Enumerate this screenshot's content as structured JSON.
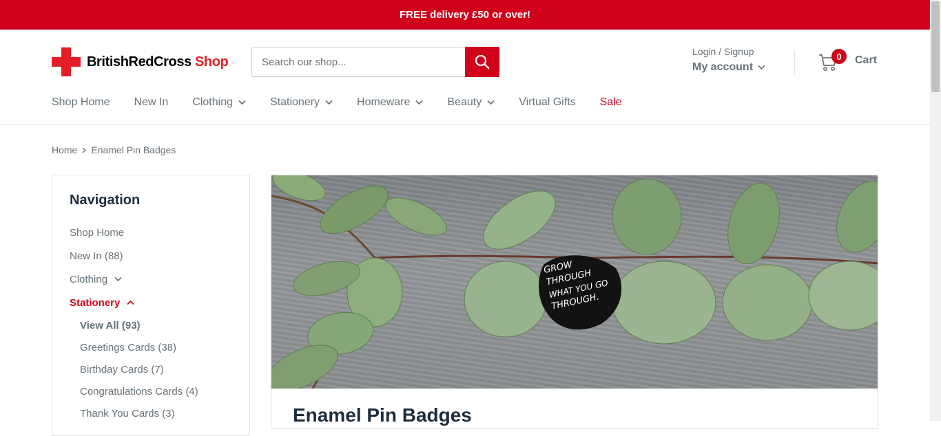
{
  "announcement": "FREE delivery £50 or over!",
  "brand": {
    "name": "BritishRedCross",
    "suffix": " Shop"
  },
  "search": {
    "placeholder": "Search our shop..."
  },
  "account": {
    "login": "Login / Signup",
    "my_account": "My account"
  },
  "cart": {
    "count": "0",
    "label": "Cart"
  },
  "nav": [
    {
      "label": "Shop Home",
      "dropdown": false
    },
    {
      "label": "New In",
      "dropdown": false
    },
    {
      "label": "Clothing",
      "dropdown": true
    },
    {
      "label": "Stationery",
      "dropdown": true
    },
    {
      "label": "Homeware",
      "dropdown": true
    },
    {
      "label": "Beauty",
      "dropdown": true
    },
    {
      "label": "Virtual Gifts",
      "dropdown": false
    },
    {
      "label": "Sale",
      "dropdown": false
    }
  ],
  "breadcrumb": {
    "home": "Home",
    "current": "Enamel Pin Badges"
  },
  "sidebar": {
    "title": "Navigation",
    "items": [
      {
        "label": "Shop Home"
      },
      {
        "label": "New In (88)"
      },
      {
        "label": "Clothing"
      },
      {
        "label": "Stationery"
      }
    ],
    "sub_items": [
      {
        "label": "View All (93)"
      },
      {
        "label": "Greetings Cards (38)"
      },
      {
        "label": "Birthday Cards (7)"
      },
      {
        "label": "Congratulations Cards (4)"
      },
      {
        "label": "Thank You Cards (3)"
      }
    ]
  },
  "banner": {
    "badge_text": [
      "GROW",
      "THROUGH",
      "WHAT YOU GO",
      "THROUGH."
    ]
  },
  "page_title": "Enamel Pin Badges",
  "colors": {
    "accent": "#d0021b",
    "text": "#677279",
    "heading": "#1e2d3b"
  }
}
